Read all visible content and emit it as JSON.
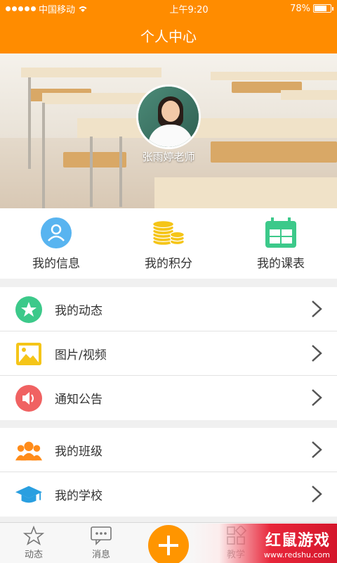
{
  "status": {
    "carrier": "中国移动",
    "time": "上午9:20",
    "battery": "78%",
    "battery_level": 0.78
  },
  "header": {
    "title": "个人中心"
  },
  "profile": {
    "name": "张雨婷老师"
  },
  "quick": [
    {
      "label": "我的信息",
      "icon": "user-icon"
    },
    {
      "label": "我的积分",
      "icon": "coins-icon"
    },
    {
      "label": "我的课表",
      "icon": "calendar-icon"
    }
  ],
  "menu1": [
    {
      "label": "我的动态",
      "icon": "star-icon",
      "color": "#3cc98a"
    },
    {
      "label": "图片/视频",
      "icon": "image-icon",
      "color": "#f5c518"
    },
    {
      "label": "通知公告",
      "icon": "speaker-icon",
      "color": "#f06262"
    }
  ],
  "menu2": [
    {
      "label": "我的班级",
      "icon": "group-icon",
      "color": "#ff8c1a"
    },
    {
      "label": "我的学校",
      "icon": "graduation-cap-icon",
      "color": "#2a9fe0"
    }
  ],
  "tabs": [
    {
      "label": "动态",
      "icon": "star-outline-icon"
    },
    {
      "label": "消息",
      "icon": "chat-icon"
    },
    {
      "label": "教学",
      "icon": "grid-icon"
    }
  ],
  "fab": {
    "icon": "plus-icon"
  },
  "watermark": {
    "title": "红鼠游戏",
    "url": "www.redshu.com"
  }
}
